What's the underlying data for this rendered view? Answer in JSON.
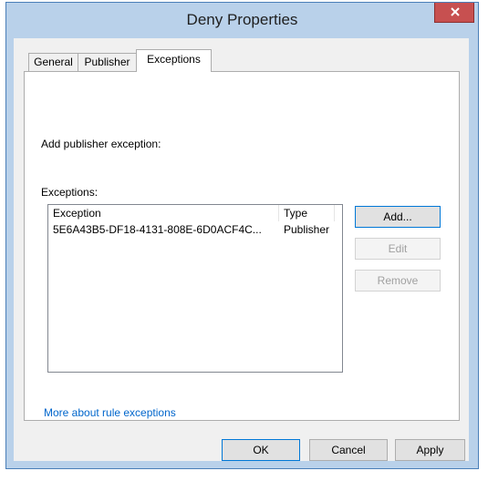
{
  "window": {
    "title": "Deny Properties"
  },
  "tabs": [
    {
      "label": "General"
    },
    {
      "label": "Publisher"
    },
    {
      "label": "Exceptions"
    }
  ],
  "panel": {
    "add_label": "Add publisher exception:",
    "exceptions_label": "Exceptions:",
    "columns": [
      "Exception",
      "Type"
    ],
    "rows": [
      {
        "exception": "5E6A43B5-DF18-4131-808E-6D0ACF4C...",
        "type": "Publisher"
      }
    ],
    "buttons": {
      "add": "Add...",
      "edit": "Edit",
      "remove": "Remove"
    },
    "link": "More about rule exceptions"
  },
  "footer": {
    "ok": "OK",
    "cancel": "Cancel",
    "apply": "Apply"
  },
  "colors": {
    "title_bar": "#b9d1ea",
    "close_button": "#c75050",
    "link": "#0066cc"
  }
}
